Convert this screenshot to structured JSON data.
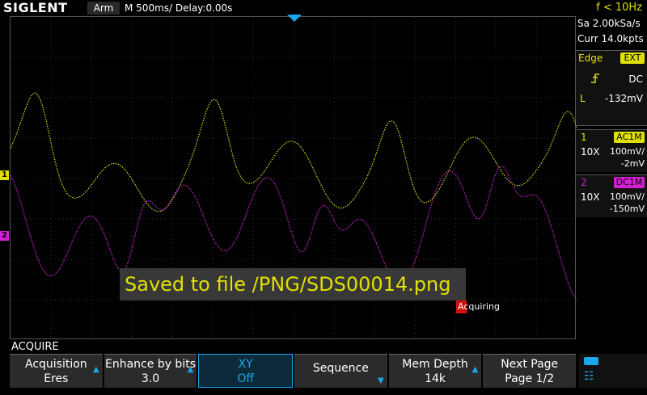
{
  "header": {
    "brand": "SIGLENT",
    "run_status": "Arm",
    "timebase": "M 500ms/  Delay:0.00s",
    "trigger_frequency": "f < 10Hz"
  },
  "acquisition_info": {
    "sample_rate": "Sa 2.00kSa/s",
    "memory": "Curr 14.0kpts"
  },
  "trigger": {
    "type": "Edge",
    "source": "EXT",
    "slope_icon": "rising-edge-icon",
    "coupling": "DC",
    "level_label": "L",
    "level": "-132mV"
  },
  "channels": [
    {
      "num": "1",
      "coupling": "AC1M",
      "probe": "10X",
      "volts_div": "100mV/",
      "offset": "-2mV",
      "color": "#e0e000"
    },
    {
      "num": "2",
      "coupling": "DC1M",
      "probe": "10X",
      "volts_div": "100mV/",
      "offset": "-150mV",
      "color": "#d31ed3"
    }
  ],
  "ch_markers": {
    "ch1": "1",
    "ch2": "2"
  },
  "message": "Saved to file /PNG/SDS00014.png",
  "acquiring_label": "Acquiring",
  "menu": {
    "title": "ACQUIRE",
    "softkeys": [
      {
        "label": "Acquisition",
        "value": "Eres"
      },
      {
        "label": "Enhance by bits",
        "value": "3.0"
      },
      {
        "label": "XY",
        "value": "Off"
      },
      {
        "label": "Sequence",
        "value": ""
      },
      {
        "label": "Mem Depth",
        "value": "14k"
      },
      {
        "label": "Next Page",
        "value": "Page 1/2"
      }
    ]
  },
  "system_icons": [
    "usb-icon",
    "network-icon"
  ]
}
